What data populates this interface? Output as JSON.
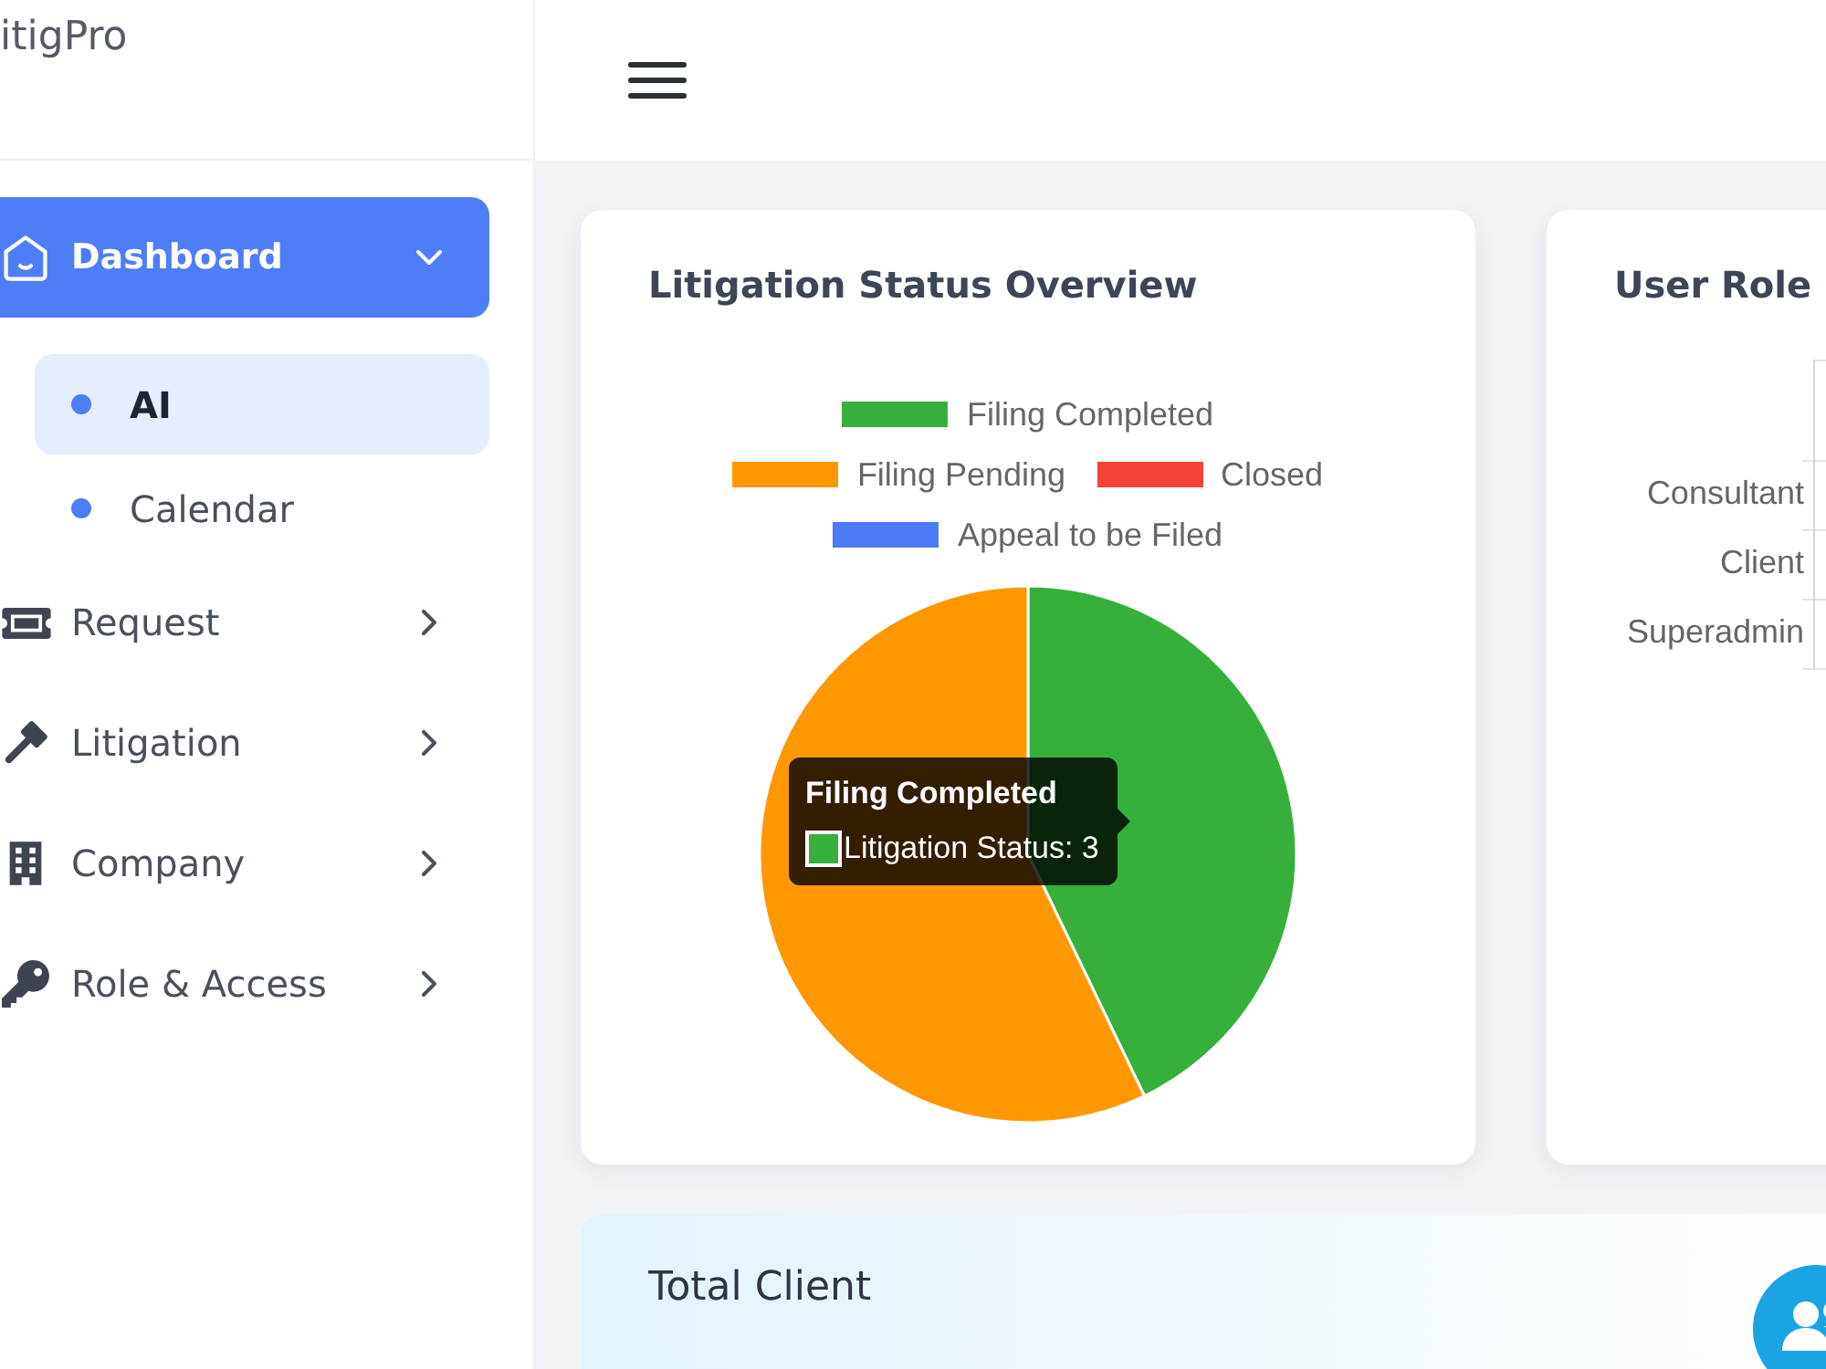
{
  "sidebar": {
    "logo": "itigPro",
    "items": [
      {
        "label": "Dashboard",
        "selected": true,
        "expanded": true,
        "children": [
          {
            "label": "AI",
            "selected": true
          },
          {
            "label": "Calendar",
            "selected": false
          }
        ]
      },
      {
        "label": "Request",
        "selected": false,
        "expanded": false
      },
      {
        "label": "Litigation",
        "selected": false,
        "expanded": false
      },
      {
        "label": "Company",
        "selected": false,
        "expanded": false
      },
      {
        "label": "Role & Access",
        "selected": false,
        "expanded": false
      }
    ]
  },
  "litigation_card": {
    "title": "Litigation Status Overview",
    "chart_data": {
      "type": "pie",
      "legend": "top",
      "categories": [
        "Filing Completed",
        "Filing Pending",
        "Closed",
        "Appeal to be Filed"
      ],
      "series": [
        {
          "values": [
            42.86,
            57.14,
            0,
            0
          ]
        }
      ],
      "colors": [
        "#36b03a",
        "#ff9800",
        "#f44336",
        "#4b7bf5"
      ]
    },
    "tooltip": {
      "title": "Filing Completed",
      "text": "Litigation Status: 3",
      "color": "#36b03a"
    }
  },
  "user_roles_card": {
    "title": "User Role",
    "axis_labels": [
      "Consultant",
      "Client",
      "Superadmin"
    ]
  },
  "total_client_card": {
    "title": "Total Client"
  }
}
